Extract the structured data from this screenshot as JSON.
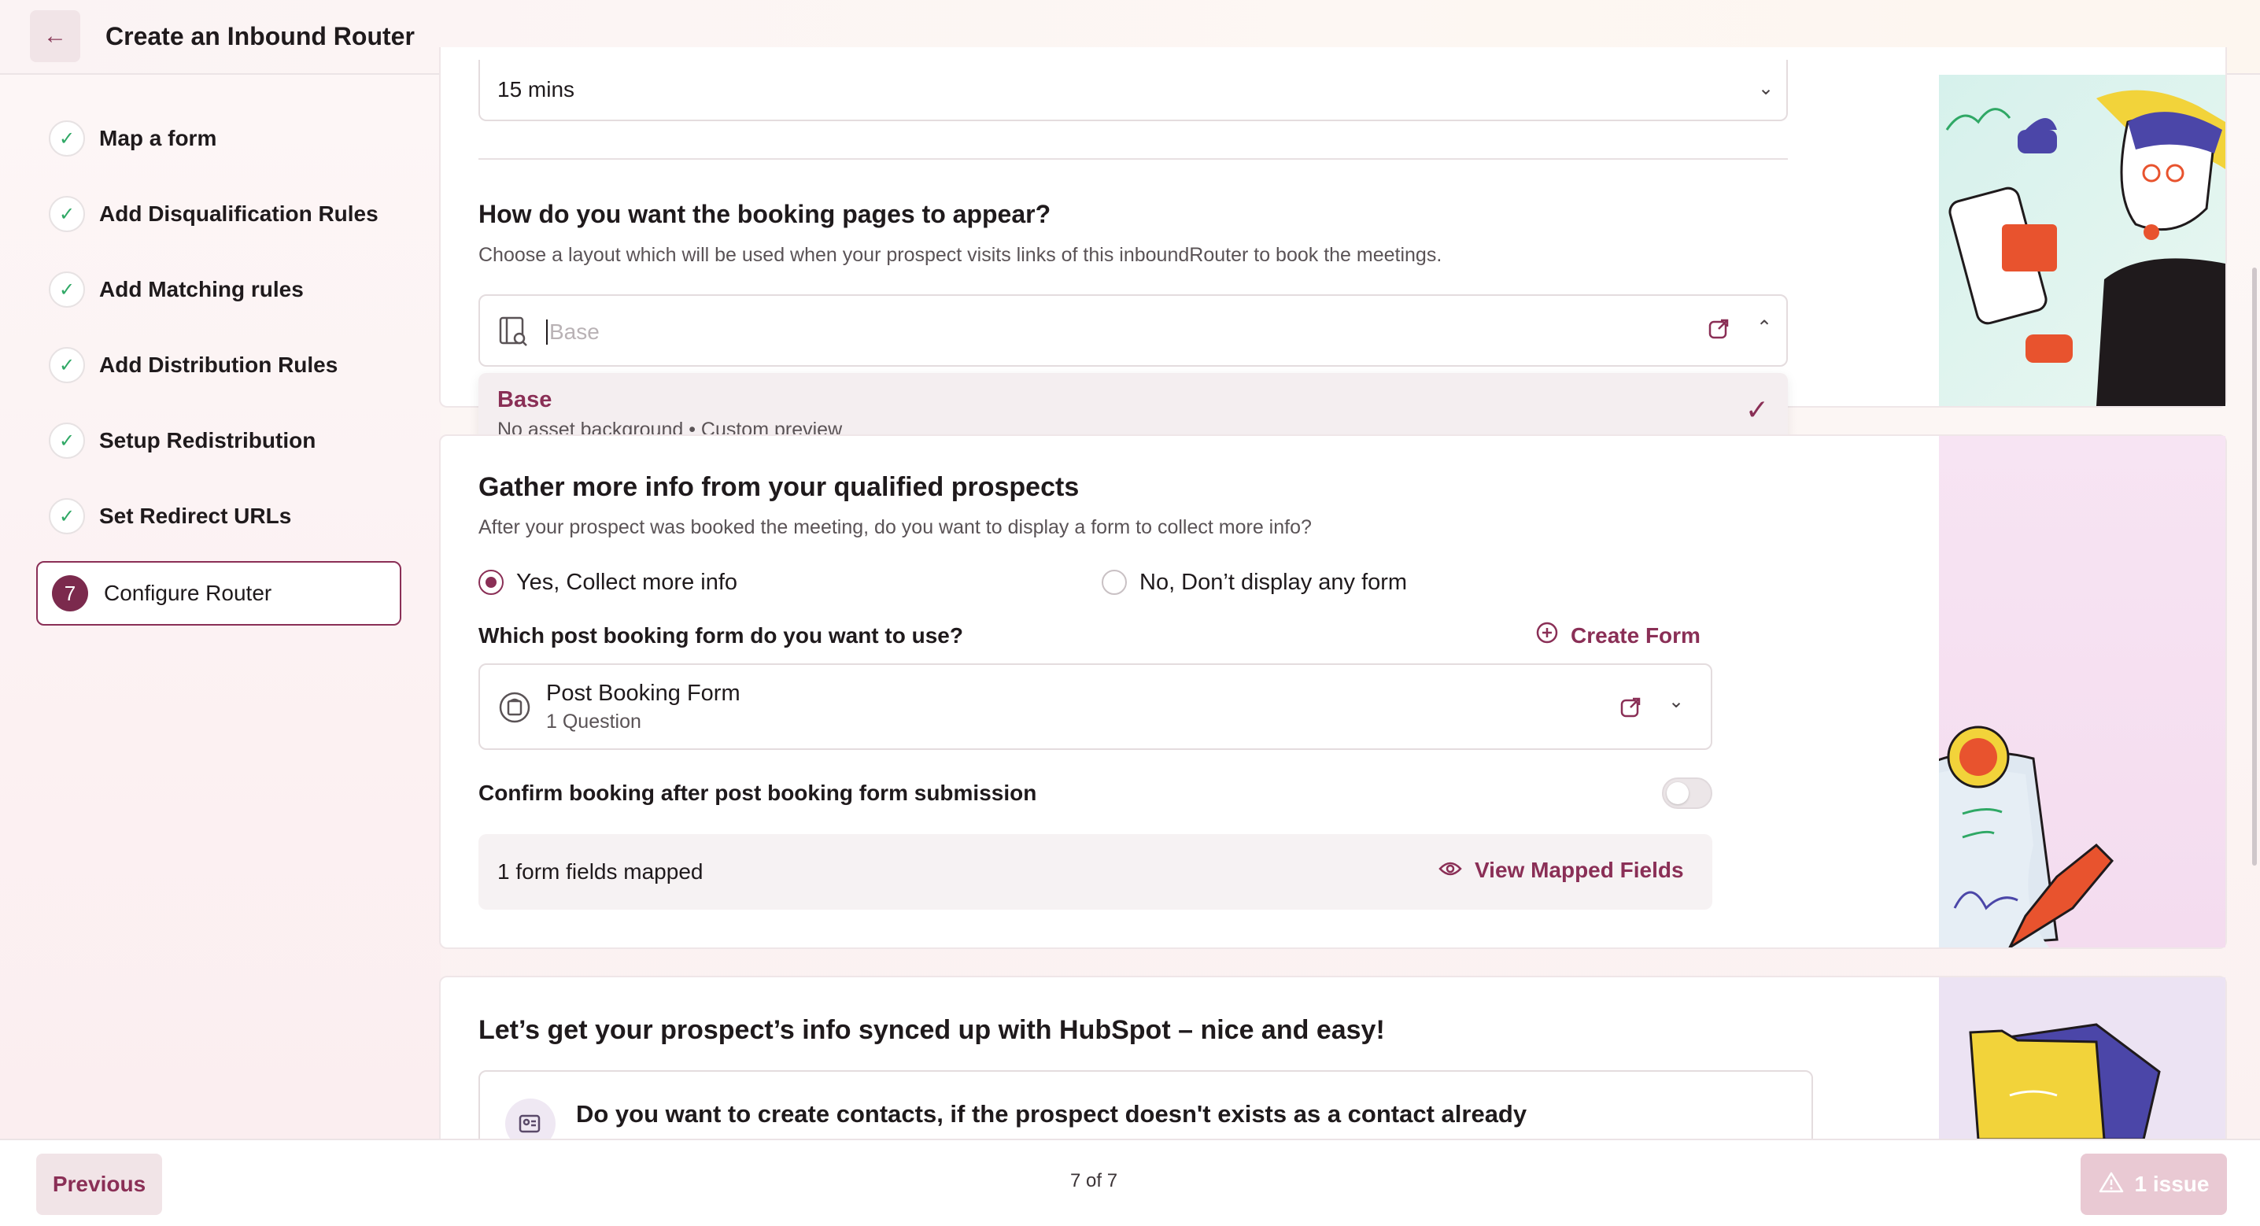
{
  "header": {
    "back_icon": "arrow-left-icon",
    "title": "Create an Inbound Router"
  },
  "sidebar": {
    "steps": [
      {
        "label": "Map a form",
        "status": "done"
      },
      {
        "label": "Add Disqualification Rules",
        "status": "done"
      },
      {
        "label": "Add Matching rules",
        "status": "done"
      },
      {
        "label": "Add Distribution Rules",
        "status": "done"
      },
      {
        "label": "Setup Redistribution",
        "status": "done"
      },
      {
        "label": "Set Redirect URLs",
        "status": "done"
      },
      {
        "label": "Configure Router",
        "number": "7",
        "status": "active"
      }
    ]
  },
  "booking": {
    "duration_value": "15 mins",
    "layout_title": "How do you want the booking pages to appear?",
    "layout_sub": "Choose a layout which will be used when your prospect visits links of this inboundRouter to book the meetings.",
    "layout_placeholder": "Base",
    "dropdown_option": {
      "title": "Base",
      "subtitle": "No asset background • Custom preview"
    }
  },
  "gather": {
    "title": "Gather more info from your qualified prospects",
    "sub": "After your prospect was booked the meeting, do you want to display a form to collect more info?",
    "radio_yes": "Yes, Collect more info",
    "radio_no": "No, Don’t display any form",
    "radio_selected": "yes",
    "which_form_label": "Which post booking form do you want to use?",
    "create_form_label": "Create Form",
    "form_name": "Post Booking Form",
    "form_questions": "1 Question",
    "confirm_label": "Confirm booking after post booking form submission",
    "confirm_enabled": false,
    "mapped_label": "1 form fields mapped",
    "view_mapped_label": "View Mapped Fields"
  },
  "hubspot": {
    "title": "Let’s get your prospect’s info synced up with HubSpot – nice and easy!",
    "question": "Do you want to create contacts, if the prospect doesn't exists as a contact already"
  },
  "footer": {
    "previous_label": "Previous",
    "page_indicator": "7 of 7",
    "issue_label": "1 issue"
  },
  "colors": {
    "accent": "#8a2f56",
    "check_green": "#2fa865"
  }
}
